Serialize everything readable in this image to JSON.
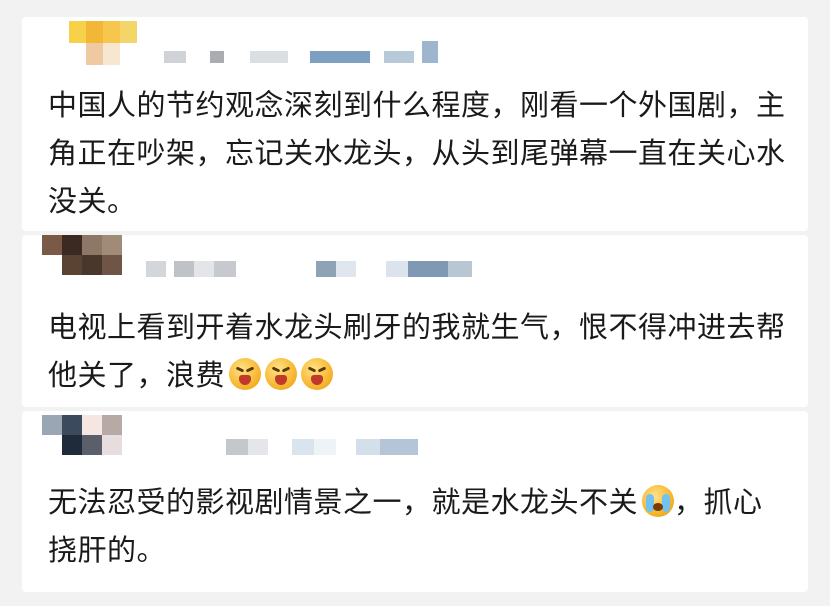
{
  "comments": [
    {
      "text": "中国人的节约观念深刻到什么程度，刚看一个外国剧，主角正在吵架，忘记关水龙头，从头到尾弹幕一直在关心水没关。",
      "emojis": []
    },
    {
      "text": "电视上看到开着水龙头刷牙的我就生气，恨不得冲进去帮他关了，浪费",
      "emojis": [
        "angry-face-emoji",
        "angry-face-emoji",
        "angry-face-emoji"
      ]
    },
    {
      "text_before": "无法忍受的影视剧情景之一，就是水龙头不关",
      "emoji": "crying-laughing-emoji",
      "text_after": "，抓心挠肝的。"
    }
  ],
  "colors": {
    "background": "#f2f2f2",
    "card": "#ffffff",
    "text": "#1a1a1a",
    "redaction_blue": "#6f93b8",
    "redaction_gray": "#c9cdd2"
  }
}
